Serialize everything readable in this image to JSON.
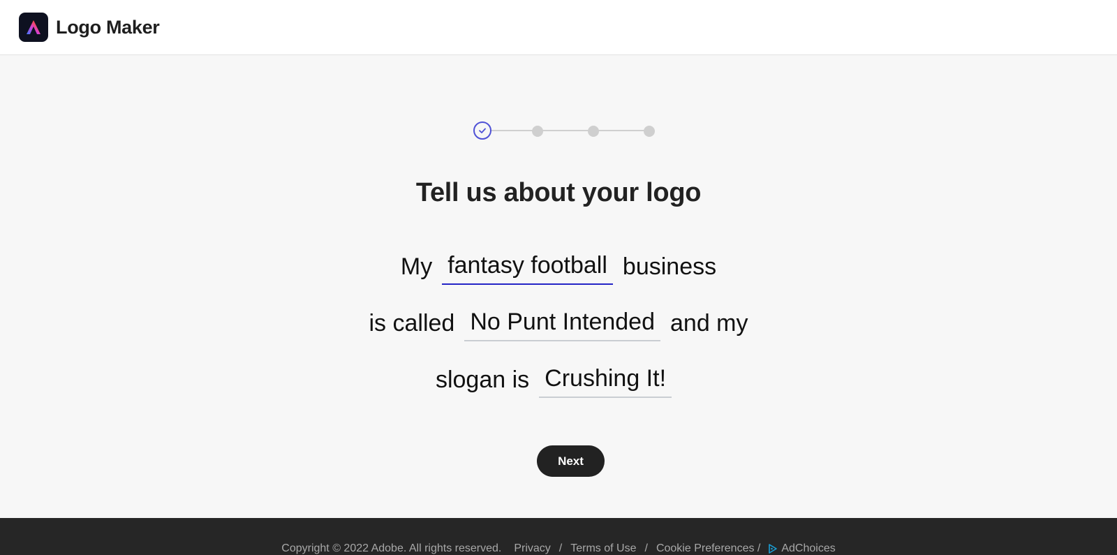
{
  "header": {
    "app_title": "Logo Maker",
    "logo_icon": "adobe-express-icon"
  },
  "stepper": {
    "total_steps": 4,
    "current_step": 1,
    "active_color": "#4f51d6",
    "inactive_color": "#cfcfcf"
  },
  "form": {
    "heading": "Tell us about your logo",
    "line1": {
      "prefix": "My",
      "field_value": "fantasy football",
      "suffix": "business"
    },
    "line2": {
      "prefix": "is called",
      "field_value": "No Punt Intended",
      "suffix": "and my"
    },
    "line3": {
      "prefix": "slogan is",
      "field_value": "Crushing It!"
    },
    "active_underline_color": "#2424c6"
  },
  "actions": {
    "next_label": "Next"
  },
  "footer": {
    "copyright": "Copyright © 2022 Adobe. All rights reserved.",
    "privacy": "Privacy",
    "sep": "/",
    "terms": "Terms of Use",
    "cookie": "Cookie Preferences /",
    "adchoices": "AdChoices"
  }
}
